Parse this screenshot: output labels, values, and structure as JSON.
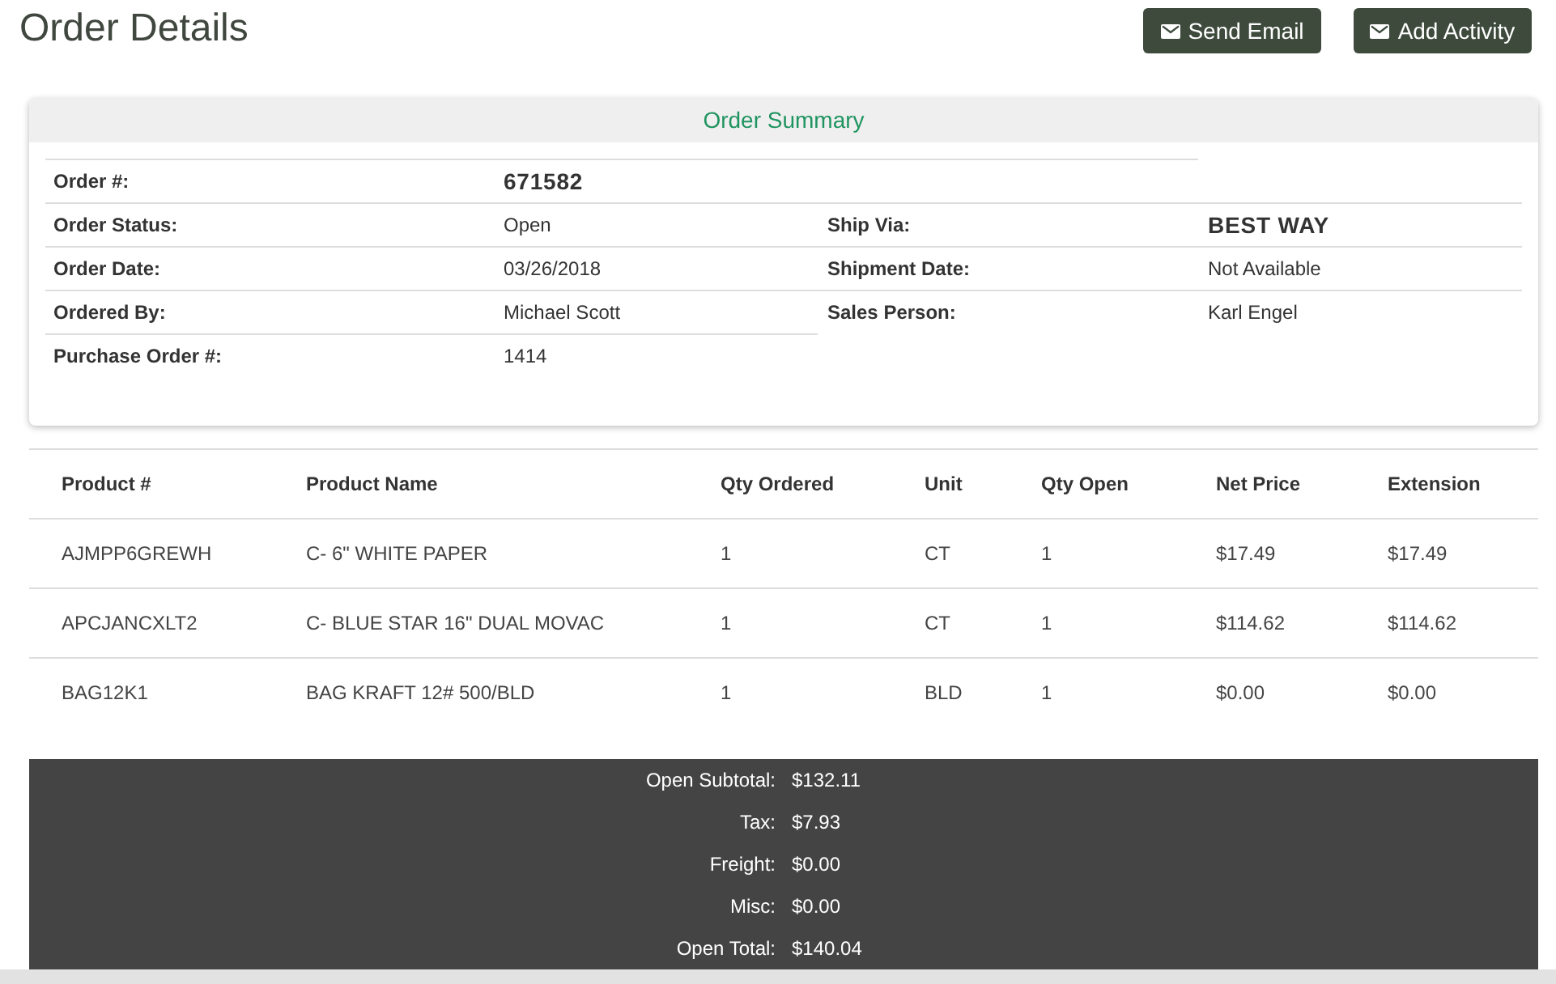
{
  "header": {
    "title": "Order Details",
    "buttons": [
      {
        "label": "Send Email"
      },
      {
        "label": "Add Activity"
      }
    ]
  },
  "order_summary": {
    "title": "Order Summary",
    "order_number": {
      "label": "Order #:",
      "value": "671582"
    },
    "left_fields": [
      {
        "label": "Order Status:",
        "value": "Open",
        "kind": "plain"
      },
      {
        "label": "Order Date:",
        "value": "03/26/2018",
        "kind": "plain"
      },
      {
        "label": "Ordered By:",
        "value": "Michael Scott",
        "kind": "plain"
      },
      {
        "label": "Purchase Order #:",
        "value": "1414",
        "kind": "plain"
      }
    ],
    "right_fields": [
      {
        "label": "Ship Via:",
        "value": "BEST WAY",
        "kind": "strong"
      },
      {
        "label": "Shipment Date:",
        "value": "Not Available",
        "kind": "plain"
      },
      {
        "label": "Sales Person:",
        "value": "Karl Engel",
        "kind": "plain"
      }
    ]
  },
  "line_items": {
    "columns": [
      "Product #",
      "Product Name",
      "Qty Ordered",
      "Unit",
      "Qty Open",
      "Net Price",
      "Extension"
    ],
    "rows": [
      [
        "AJMPP6GREWH",
        "C- 6\" WHITE PAPER",
        "1",
        "CT",
        "1",
        "$17.49",
        "$17.49"
      ],
      [
        "APCJANCXLT2",
        "C- BLUE STAR 16\" DUAL MOVAC",
        "1",
        "CT",
        "1",
        "$114.62",
        "$114.62"
      ],
      [
        "BAG12K1",
        "BAG KRAFT 12# 500/BLD",
        "1",
        "BLD",
        "1",
        "$0.00",
        "$0.00"
      ]
    ]
  },
  "totals": [
    {
      "label": "Open Subtotal:",
      "value": "$132.11"
    },
    {
      "label": "Tax:",
      "value": "$7.93"
    },
    {
      "label": "Freight:",
      "value": "$0.00"
    },
    {
      "label": "Misc:",
      "value": "$0.00"
    },
    {
      "label": "Open Total:",
      "value": "$140.04"
    }
  ]
}
